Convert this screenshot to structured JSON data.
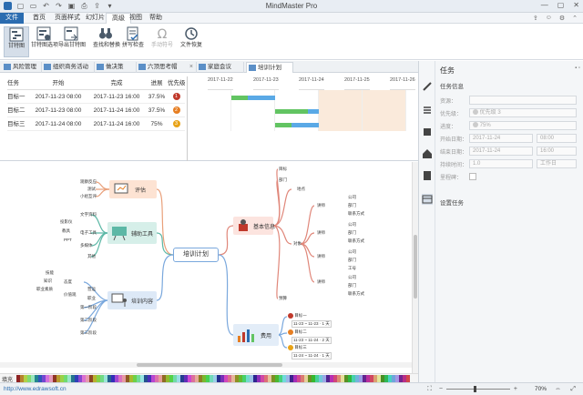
{
  "app": {
    "title": "MindMaster Pro"
  },
  "menu": {
    "items": [
      "文件",
      "首页",
      "页面样式",
      "幻灯片",
      "高级",
      "视图",
      "帮助"
    ]
  },
  "ribbon": {
    "buttons": [
      {
        "label": "甘特图",
        "icon": "gantt-icon",
        "selected": true
      },
      {
        "label": "甘特图选项",
        "icon": "gantt-options-icon"
      },
      {
        "label": "导出甘特图",
        "icon": "export-gantt-icon"
      },
      {
        "label": "查找和替换",
        "icon": "binoculars-icon"
      },
      {
        "label": "拼写检查",
        "icon": "spellcheck-icon"
      },
      {
        "label": "手动符号",
        "icon": "omega-icon",
        "disabled": true
      },
      {
        "label": "文件恢复",
        "icon": "file-restore-icon"
      }
    ]
  },
  "tabs": [
    {
      "label": "风险管理"
    },
    {
      "label": "组织商务活动"
    },
    {
      "label": "做决策"
    },
    {
      "label": "六顶思考帽"
    },
    {
      "label": "家庭会议"
    },
    {
      "label": "培训计划",
      "active": true
    }
  ],
  "gantt": {
    "headers": [
      "任务",
      "开始",
      "完成",
      "进展",
      "优先级"
    ],
    "rows": [
      {
        "task": "目标一",
        "start": "2017-11-23 08:00",
        "end": "2017-11-23 16:00",
        "progress": "37.5%",
        "priority": "1",
        "priority_color": "#c0392b"
      },
      {
        "task": "目标二",
        "start": "2017-11-23 08:00",
        "end": "2017-11-24 16:00",
        "progress": "37.5%",
        "priority": "2",
        "priority_color": "#e67e22"
      },
      {
        "task": "目标三",
        "start": "2017-11-24 08:00",
        "end": "2017-11-24 16:00",
        "progress": "75%",
        "priority": "3",
        "priority_color": "#e8a317"
      }
    ],
    "dates": [
      "2017-11-22",
      "2017-11-23",
      "2017-11-24",
      "2017-11-25",
      "2017-11-26"
    ]
  },
  "mindmap": {
    "central": "培训计划",
    "branches": {
      "eval": "评估",
      "tools": "辅助工具",
      "content": "培训内容",
      "info": "基本信息",
      "budget": "费用"
    },
    "eval_leaves": [
      "观察反应",
      "测试",
      "小组互评"
    ],
    "tools_leaves": [
      "投影仪",
      "教具",
      "PPT",
      "文字资料",
      "电子工具",
      "多媒体",
      "其他"
    ],
    "content_leaves": [
      "技能",
      "知识",
      "职业素质",
      "态度",
      "价值观",
      "第一阶段",
      "第二阶段",
      "第三阶段",
      "营运",
      "职业"
    ],
    "info_leaves": [
      "目标",
      "部门",
      "地点",
      "对象",
      "讲师",
      "课程",
      "时间",
      "公司",
      "部门",
      "联系方式",
      "工号",
      "预算"
    ],
    "budget_leaves": [
      "目标一",
      "目标二",
      "目标三",
      "11-23 ~ 11-23 · 1 天",
      "11-23 ~ 11-24 · 2 天",
      "11-24 ~ 11-24 · 1 天"
    ]
  },
  "sidebar": {
    "title": "任务",
    "section_info": "任务信息",
    "fields": [
      {
        "label": "资源：",
        "value": ""
      },
      {
        "label": "优先级：",
        "value": "优先级 3"
      },
      {
        "label": "进度：",
        "value": "75%"
      },
      {
        "label": "开始日期：",
        "value": "2017-11-24",
        "time": "08:00"
      },
      {
        "label": "结束日期：",
        "value": "2017-11-24",
        "time": "16:00"
      },
      {
        "label": "持续时间：",
        "value": "1.0",
        "time": "工作日"
      },
      {
        "label": "里程碑：",
        "value": ""
      }
    ],
    "section_tasks": "设置任务"
  },
  "palette": {
    "label": "填充"
  },
  "status": {
    "url": "http://www.edrawsoft.cn",
    "zoom": "70%"
  },
  "colors": {
    "accent": "#2b6cb0",
    "gantt_done": "#62c462",
    "gantt_todo": "#5aa9e6"
  }
}
